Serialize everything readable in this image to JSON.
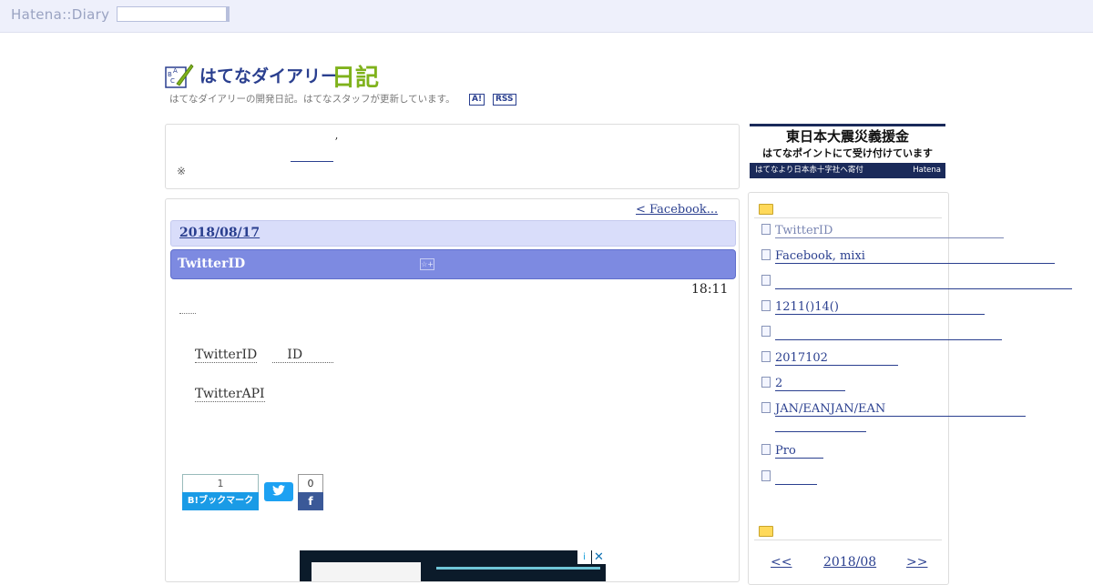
{
  "topbar": {
    "logo": "Hatena::Diary",
    "search_value": ""
  },
  "header": {
    "title_main": "はてなダイアリー",
    "title_accent": "日記",
    "description": "はてなダイアリーの開発日記。はてなスタッフが更新しています。",
    "feed_a": "A!",
    "feed_rss": "RSS"
  },
  "notice": {
    "dot": "ʼ",
    "note": "※"
  },
  "banner": {
    "line1": "東日本大震災義援金",
    "line2": "はてなポイントにて受け付けています",
    "line3": "はてなより日本赤十字社へ寄付",
    "brand": "Hatena"
  },
  "main": {
    "prev_link": "< Facebook...",
    "date": "2018/08/17",
    "section_title": "TwitterID",
    "star_icon": "☆+",
    "time": "18:11",
    "para1_a": "TwitterID",
    "para1_b": "ID",
    "para2": "TwitterAPI"
  },
  "share": {
    "hatena_count": "1",
    "hatena_label": "B!ブックマーク",
    "twitter_icon": "twitter-bird",
    "facebook_count": "0",
    "facebook_icon": "f"
  },
  "ad": {
    "info": "i",
    "close": "✕"
  },
  "sidebar": {
    "recent_entries": [
      {
        "label": "TwitterID",
        "visited": true
      },
      {
        "label": "Facebook, mixi",
        "visited": false
      },
      {
        "label": "",
        "visited": false
      },
      {
        "label": "1211()14()",
        "visited": false
      },
      {
        "label": "",
        "visited": false
      },
      {
        "label": "2017102",
        "visited": false
      },
      {
        "label": "2",
        "visited": false
      },
      {
        "label": "JAN/EANJAN/EAN",
        "visited": false
      },
      {
        "label": "Pro",
        "visited": false
      },
      {
        "label": "",
        "visited": false
      }
    ],
    "calendar": {
      "prev": "<<",
      "month": "2018/08",
      "next": ">>"
    }
  },
  "colors": {
    "accent": "#2a3f8f",
    "section": "#7d8ae1",
    "date_bar": "#d9ddfa",
    "title_accent": "#7fb21c"
  }
}
